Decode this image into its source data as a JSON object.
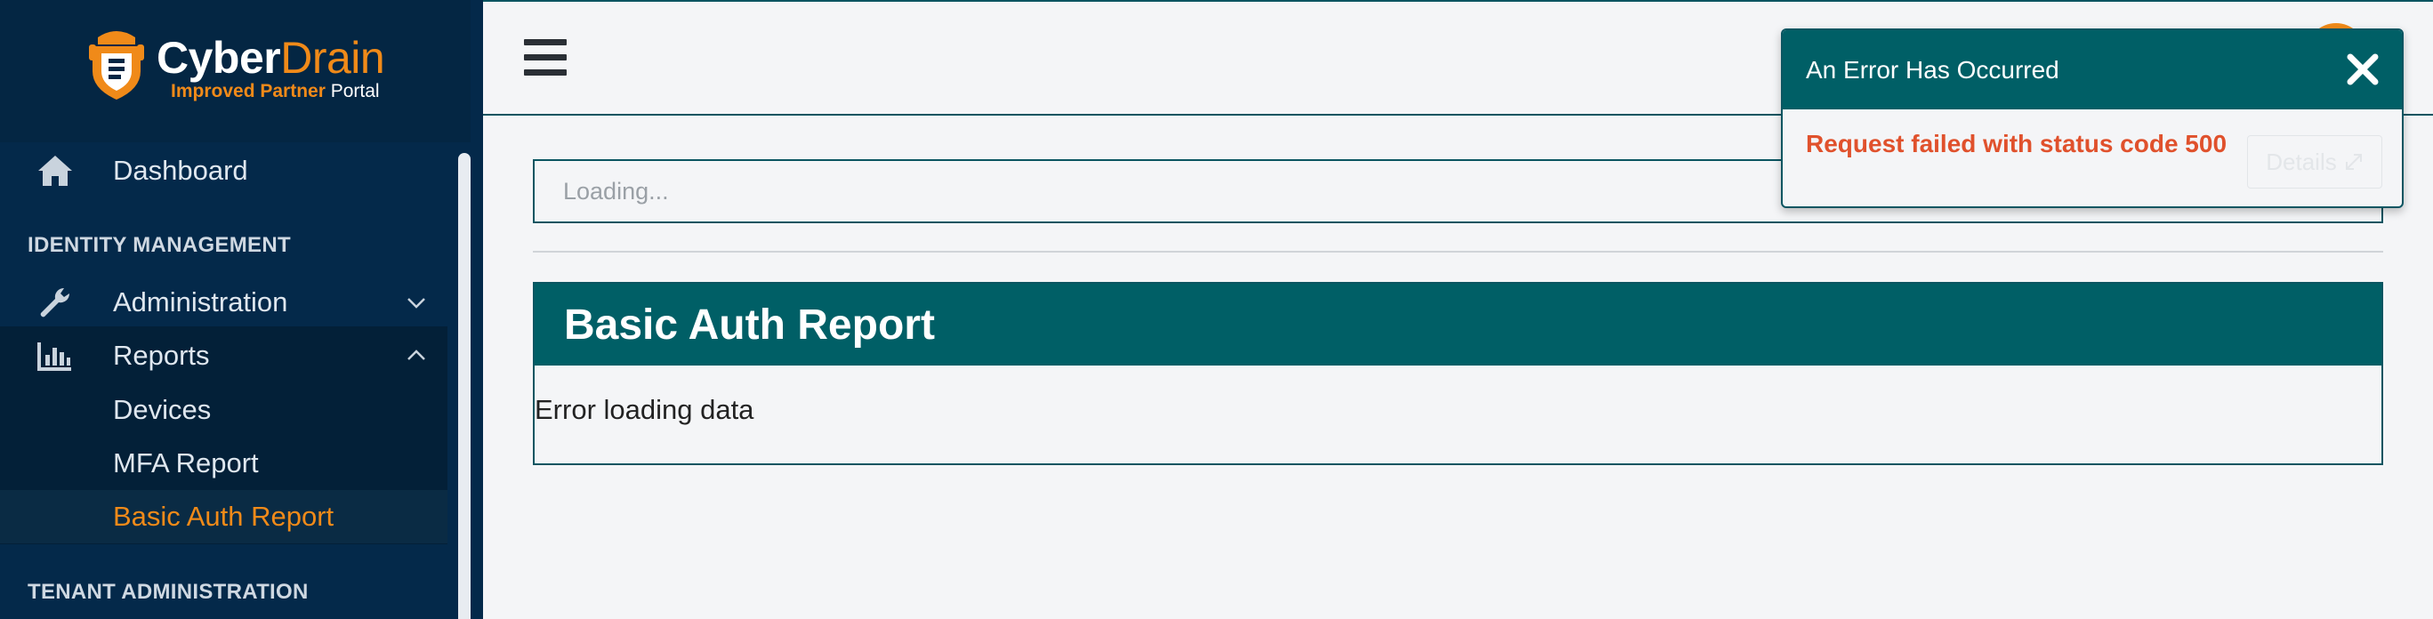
{
  "brand": {
    "name_part1": "Cyber",
    "name_part2": "Drain",
    "sub_part1": "Improved Partner",
    "sub_part2": "Portal",
    "icon": "cyberdrain-logo-icon"
  },
  "sidebar": {
    "dashboard": {
      "label": "Dashboard",
      "icon": "home-icon"
    },
    "section_identity": "IDENTITY MANAGEMENT",
    "administration": {
      "label": "Administration",
      "icon": "wrench-icon",
      "chevron": "chevron-down-icon"
    },
    "reports": {
      "label": "Reports",
      "icon": "bar-chart-icon",
      "chevron": "chevron-up-icon",
      "items": [
        {
          "label": "Devices"
        },
        {
          "label": "MFA Report"
        },
        {
          "label": "Basic Auth Report",
          "active": true
        }
      ]
    },
    "section_tenant": "TENANT ADMINISTRATION"
  },
  "header": {
    "menu_icon": "hamburger-menu-icon"
  },
  "main": {
    "tenant_select_placeholder": "Loading...",
    "card_title": "Basic Auth Report",
    "card_body": "Error loading data"
  },
  "toast": {
    "title": "An Error Has Occurred",
    "message": "Request failed with status code 500",
    "details_label": "Details",
    "close_icon": "close-icon",
    "expand_icon": "expand-icon"
  },
  "colors": {
    "sidebar_bg": "#04294a",
    "accent_orange": "#f08a19",
    "teal": "#005f66",
    "error_red": "#e0512c"
  }
}
